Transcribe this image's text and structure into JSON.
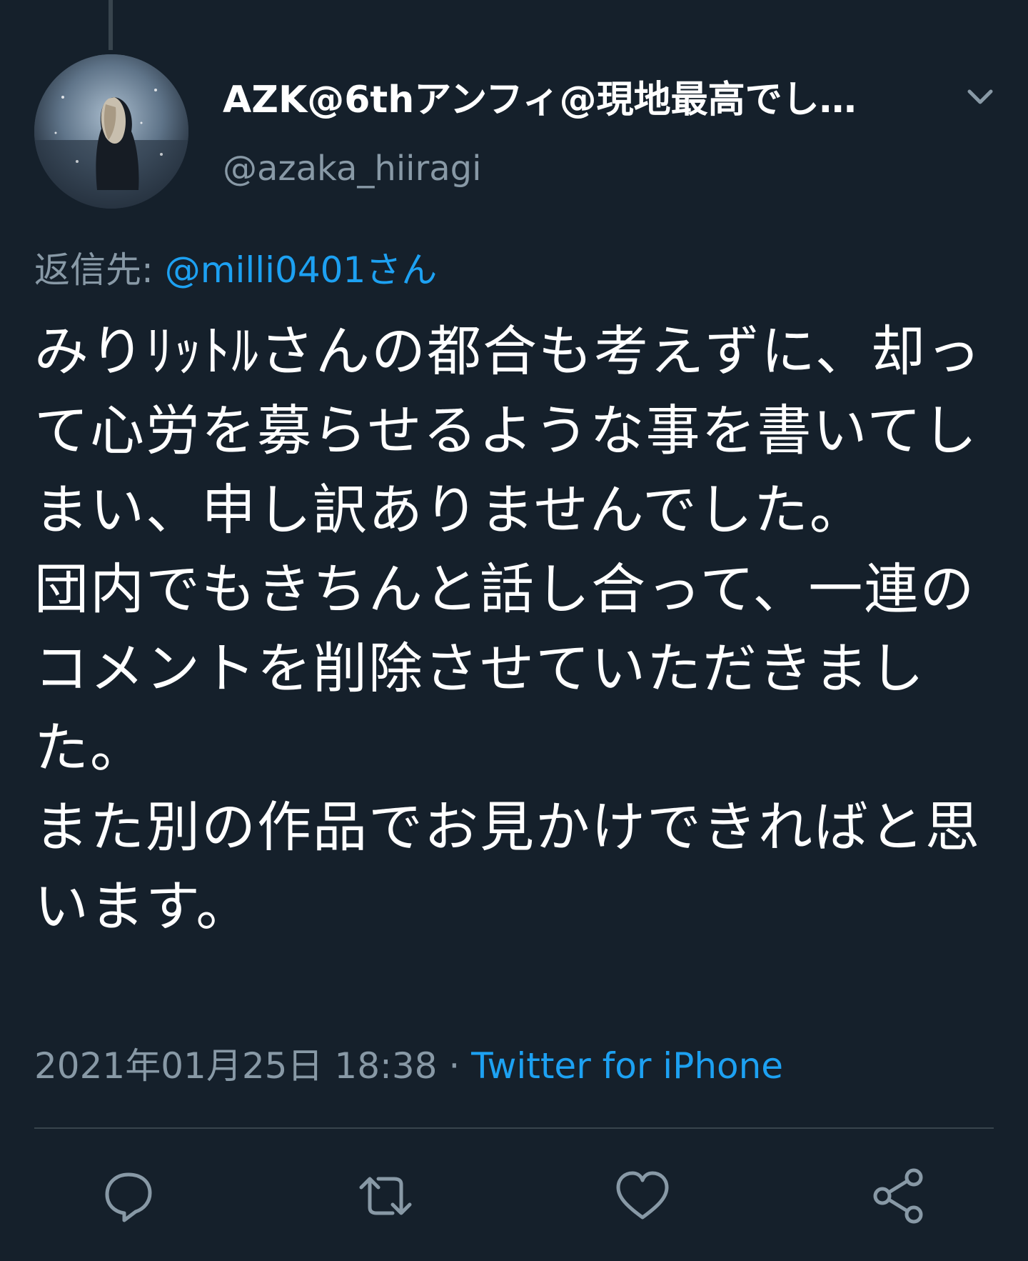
{
  "tweet": {
    "display_name": "AZK@6thアンフィ@現地最高でし…",
    "handle": "@azaka_hiiragi",
    "reply_prefix": "返信先: ",
    "reply_mention": "@milli0401さん",
    "body": "みりﾘｯﾄﾙさんの都合も考えずに、却って心労を募らせるような事を書いてしまい、申し訳ありませんでした。\n団内でもきちんと話し合って、一連のコメントを削除させていただきました。\nまた別の作品でお見かけできればと思います。",
    "timestamp": "2021年01月25日 18:38",
    "separator": " · ",
    "source": "Twitter for iPhone"
  },
  "icons": {
    "caret": "chevron-down-icon",
    "reply": "reply-icon",
    "retweet": "retweet-icon",
    "like": "heart-icon",
    "share": "share-icon"
  },
  "colors": {
    "background": "#15202b",
    "secondary_text": "#8899a6",
    "link": "#1da1f2",
    "divider": "#38444d"
  }
}
